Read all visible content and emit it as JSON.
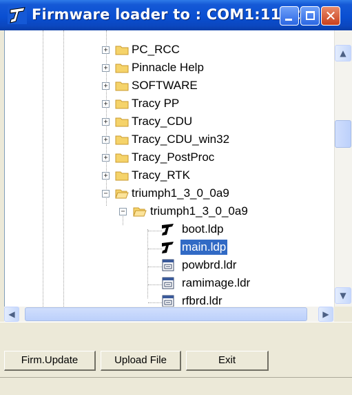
{
  "window": {
    "title": "Firmware loader to : COM1:1152...",
    "buttons": {
      "minimize": "minimize",
      "maximize": "maximize",
      "close": "close"
    }
  },
  "tree": {
    "items": [
      {
        "label": "PC_RCC",
        "expander": "+"
      },
      {
        "label": "Pinnacle Help",
        "expander": "+"
      },
      {
        "label": "SOFTWARE",
        "expander": "+"
      },
      {
        "label": "Tracy PP",
        "expander": "+"
      },
      {
        "label": "Tracy_CDU",
        "expander": "+"
      },
      {
        "label": "Tracy_CDU_win32",
        "expander": "+"
      },
      {
        "label": "Tracy_PostProc",
        "expander": "+"
      },
      {
        "label": "Tracy_RTK",
        "expander": "+"
      },
      {
        "label": "triumph1_3_0_0a9",
        "expander": "−"
      },
      {
        "label": "triumph1_3_0_0a9",
        "expander": "−"
      },
      {
        "label": "boot.ldp",
        "icon": "jlogo-icon"
      },
      {
        "label": "main.ldp",
        "icon": "jlogo-icon",
        "selected": true
      },
      {
        "label": "powbrd.ldr",
        "icon": "file-icon"
      },
      {
        "label": "ramimage.ldr",
        "icon": "file-icon"
      },
      {
        "label": "rfbrd.ldr",
        "icon": "file-icon"
      }
    ]
  },
  "buttons": {
    "firm_update": "Firm.Update",
    "upload_file": "Upload File",
    "exit": "Exit"
  },
  "colors": {
    "titlebar": "#0a4fd2",
    "selection": "#316ac5",
    "folder": "#f5d36a"
  }
}
